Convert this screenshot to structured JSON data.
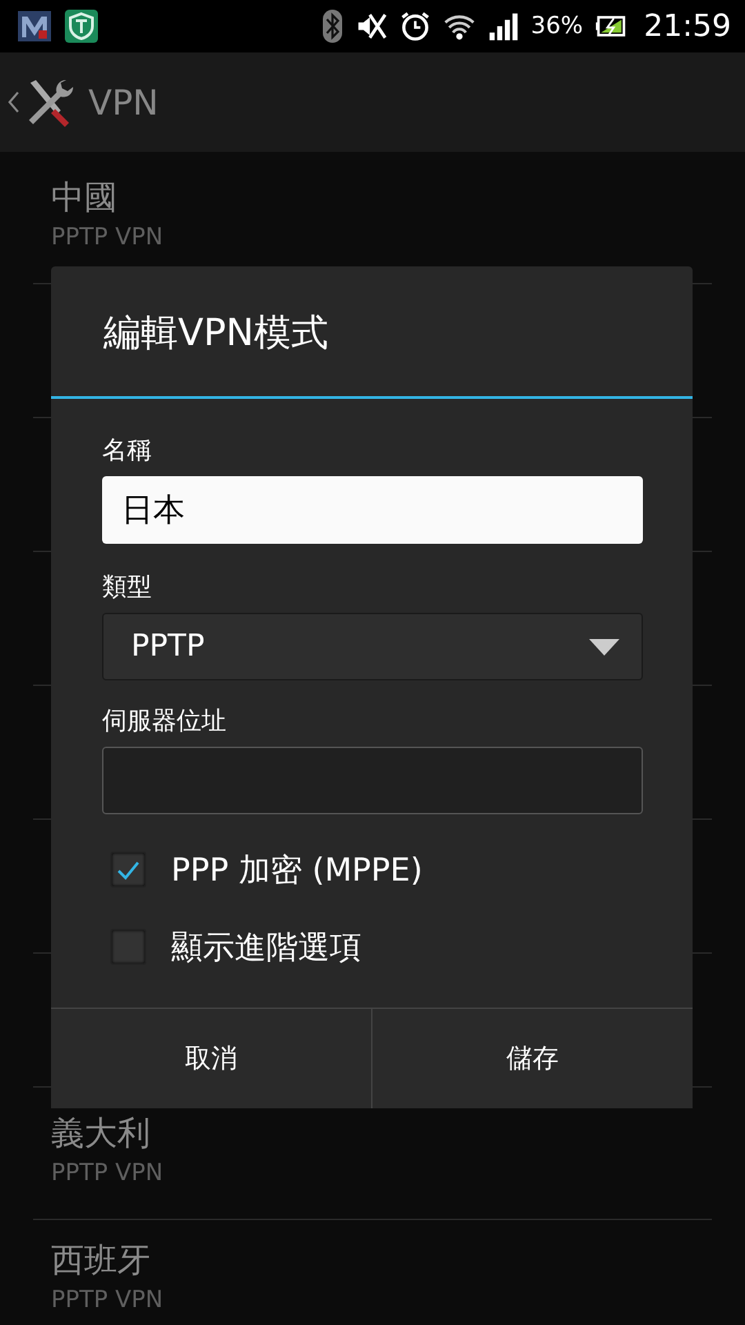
{
  "status_bar": {
    "battery": "36%",
    "time": "21:59"
  },
  "action_bar": {
    "title": "VPN"
  },
  "vpn_list": [
    {
      "name": "中國",
      "type": "PPTP VPN"
    },
    {
      "name": "義大利",
      "type": "PPTP VPN"
    },
    {
      "name": "西班牙",
      "type": "PPTP VPN"
    }
  ],
  "dialog": {
    "title": "編輯VPN模式",
    "fields": [
      {
        "kind": "text",
        "label": "名稱",
        "value": "日本"
      },
      {
        "kind": "dropdown",
        "label": "類型",
        "value": "PPTP"
      },
      {
        "kind": "input",
        "label": "伺服器位址"
      }
    ],
    "options": [
      {
        "label": "PPP 加密 (MPPE)",
        "checked": true
      },
      {
        "label": "顯示進階選項",
        "checked": false
      }
    ],
    "buttons": [
      "取消",
      "儲存"
    ]
  }
}
